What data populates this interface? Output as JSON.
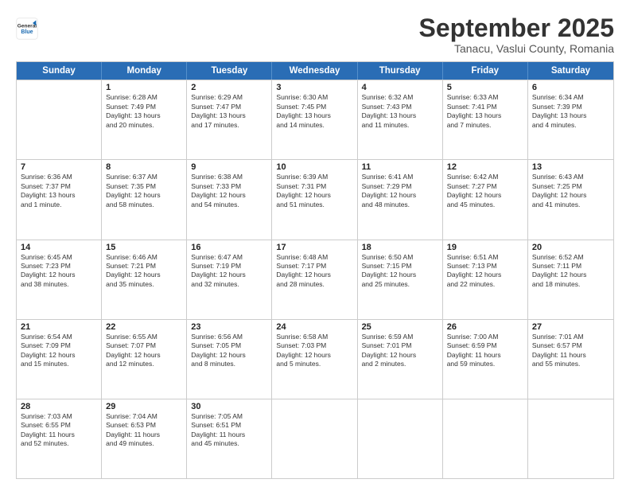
{
  "header": {
    "logo_general": "General",
    "logo_blue": "Blue",
    "month_title": "September 2025",
    "location": "Tanacu, Vaslui County, Romania"
  },
  "days_of_week": [
    "Sunday",
    "Monday",
    "Tuesday",
    "Wednesday",
    "Thursday",
    "Friday",
    "Saturday"
  ],
  "weeks": [
    [
      {
        "day": "",
        "text": ""
      },
      {
        "day": "1",
        "text": "Sunrise: 6:28 AM\nSunset: 7:49 PM\nDaylight: 13 hours\nand 20 minutes."
      },
      {
        "day": "2",
        "text": "Sunrise: 6:29 AM\nSunset: 7:47 PM\nDaylight: 13 hours\nand 17 minutes."
      },
      {
        "day": "3",
        "text": "Sunrise: 6:30 AM\nSunset: 7:45 PM\nDaylight: 13 hours\nand 14 minutes."
      },
      {
        "day": "4",
        "text": "Sunrise: 6:32 AM\nSunset: 7:43 PM\nDaylight: 13 hours\nand 11 minutes."
      },
      {
        "day": "5",
        "text": "Sunrise: 6:33 AM\nSunset: 7:41 PM\nDaylight: 13 hours\nand 7 minutes."
      },
      {
        "day": "6",
        "text": "Sunrise: 6:34 AM\nSunset: 7:39 PM\nDaylight: 13 hours\nand 4 minutes."
      }
    ],
    [
      {
        "day": "7",
        "text": "Sunrise: 6:36 AM\nSunset: 7:37 PM\nDaylight: 13 hours\nand 1 minute."
      },
      {
        "day": "8",
        "text": "Sunrise: 6:37 AM\nSunset: 7:35 PM\nDaylight: 12 hours\nand 58 minutes."
      },
      {
        "day": "9",
        "text": "Sunrise: 6:38 AM\nSunset: 7:33 PM\nDaylight: 12 hours\nand 54 minutes."
      },
      {
        "day": "10",
        "text": "Sunrise: 6:39 AM\nSunset: 7:31 PM\nDaylight: 12 hours\nand 51 minutes."
      },
      {
        "day": "11",
        "text": "Sunrise: 6:41 AM\nSunset: 7:29 PM\nDaylight: 12 hours\nand 48 minutes."
      },
      {
        "day": "12",
        "text": "Sunrise: 6:42 AM\nSunset: 7:27 PM\nDaylight: 12 hours\nand 45 minutes."
      },
      {
        "day": "13",
        "text": "Sunrise: 6:43 AM\nSunset: 7:25 PM\nDaylight: 12 hours\nand 41 minutes."
      }
    ],
    [
      {
        "day": "14",
        "text": "Sunrise: 6:45 AM\nSunset: 7:23 PM\nDaylight: 12 hours\nand 38 minutes."
      },
      {
        "day": "15",
        "text": "Sunrise: 6:46 AM\nSunset: 7:21 PM\nDaylight: 12 hours\nand 35 minutes."
      },
      {
        "day": "16",
        "text": "Sunrise: 6:47 AM\nSunset: 7:19 PM\nDaylight: 12 hours\nand 32 minutes."
      },
      {
        "day": "17",
        "text": "Sunrise: 6:48 AM\nSunset: 7:17 PM\nDaylight: 12 hours\nand 28 minutes."
      },
      {
        "day": "18",
        "text": "Sunrise: 6:50 AM\nSunset: 7:15 PM\nDaylight: 12 hours\nand 25 minutes."
      },
      {
        "day": "19",
        "text": "Sunrise: 6:51 AM\nSunset: 7:13 PM\nDaylight: 12 hours\nand 22 minutes."
      },
      {
        "day": "20",
        "text": "Sunrise: 6:52 AM\nSunset: 7:11 PM\nDaylight: 12 hours\nand 18 minutes."
      }
    ],
    [
      {
        "day": "21",
        "text": "Sunrise: 6:54 AM\nSunset: 7:09 PM\nDaylight: 12 hours\nand 15 minutes."
      },
      {
        "day": "22",
        "text": "Sunrise: 6:55 AM\nSunset: 7:07 PM\nDaylight: 12 hours\nand 12 minutes."
      },
      {
        "day": "23",
        "text": "Sunrise: 6:56 AM\nSunset: 7:05 PM\nDaylight: 12 hours\nand 8 minutes."
      },
      {
        "day": "24",
        "text": "Sunrise: 6:58 AM\nSunset: 7:03 PM\nDaylight: 12 hours\nand 5 minutes."
      },
      {
        "day": "25",
        "text": "Sunrise: 6:59 AM\nSunset: 7:01 PM\nDaylight: 12 hours\nand 2 minutes."
      },
      {
        "day": "26",
        "text": "Sunrise: 7:00 AM\nSunset: 6:59 PM\nDaylight: 11 hours\nand 59 minutes."
      },
      {
        "day": "27",
        "text": "Sunrise: 7:01 AM\nSunset: 6:57 PM\nDaylight: 11 hours\nand 55 minutes."
      }
    ],
    [
      {
        "day": "28",
        "text": "Sunrise: 7:03 AM\nSunset: 6:55 PM\nDaylight: 11 hours\nand 52 minutes."
      },
      {
        "day": "29",
        "text": "Sunrise: 7:04 AM\nSunset: 6:53 PM\nDaylight: 11 hours\nand 49 minutes."
      },
      {
        "day": "30",
        "text": "Sunrise: 7:05 AM\nSunset: 6:51 PM\nDaylight: 11 hours\nand 45 minutes."
      },
      {
        "day": "",
        "text": ""
      },
      {
        "day": "",
        "text": ""
      },
      {
        "day": "",
        "text": ""
      },
      {
        "day": "",
        "text": ""
      }
    ]
  ]
}
